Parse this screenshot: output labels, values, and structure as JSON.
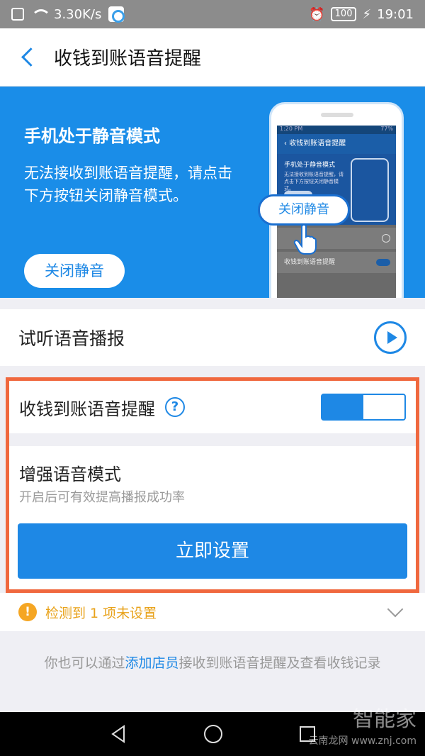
{
  "status_bar": {
    "speed": "3.30K/s",
    "battery": "100",
    "time": "19:01"
  },
  "header": {
    "title": "收钱到账语音提醒"
  },
  "banner": {
    "title": "手机处于静音模式",
    "description": "无法接收到账语音提醒，请点击下方按钮关闭静音模式。",
    "button_label": "关闭静音",
    "bubble_label": "关闭静音",
    "mock": {
      "time": "1:20 PM",
      "battery": "77%",
      "nav_title": "收钱到账语音提醒",
      "title": "手机处于静音模式",
      "description": "无法接收到账语音提醒，请点击下方按钮关闭静音模式。",
      "row2_label": "收钱到账语音提醒"
    }
  },
  "listen": {
    "label": "试听语音播报"
  },
  "alert_setting": {
    "label": "收钱到账语音提醒",
    "help": "?",
    "toggle_on": true
  },
  "enhance": {
    "title": "增强语音模式",
    "subtitle": "开启后可有效提高播报成功率",
    "button_label": "立即设置"
  },
  "detect": {
    "icon": "!",
    "text": "检测到 1 项未设置"
  },
  "footer": {
    "prefix": "你也可以通过",
    "link": "添加店员",
    "suffix": "接收到账语音提醒及查看收钱记录"
  },
  "watermark": {
    "main": "智能家",
    "sub": "云南龙网",
    "url": "www.znj.com"
  },
  "colors": {
    "accent": "#1e88e5",
    "highlight": "#f0683e",
    "warning": "#e8a21a"
  }
}
